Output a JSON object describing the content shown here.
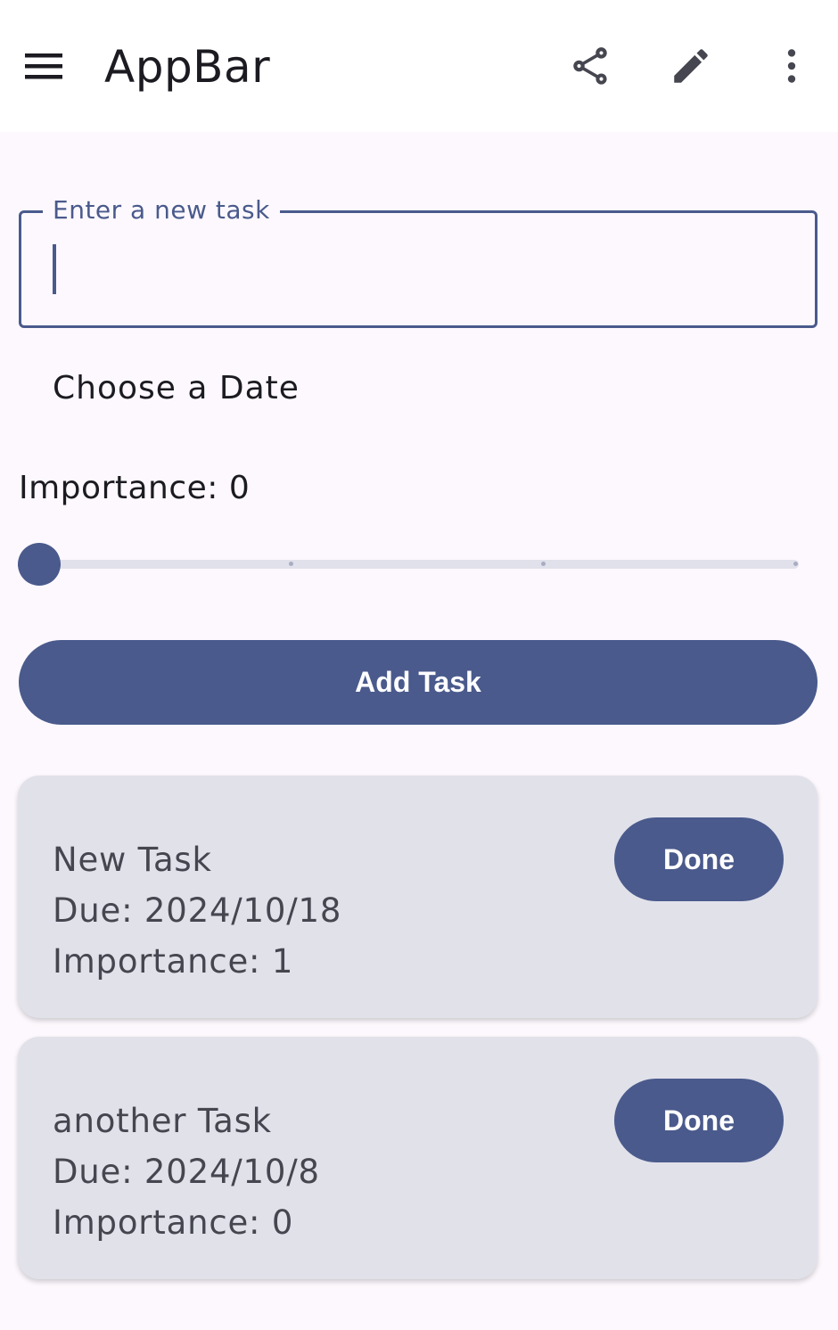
{
  "appbar": {
    "title": "AppBar",
    "icons": {
      "menu": "menu-icon",
      "share": "share-icon",
      "edit": "edit-icon",
      "more": "more-vert-icon"
    }
  },
  "form": {
    "task_input": {
      "label": "Enter a new task",
      "value": ""
    },
    "date_button_label": "Choose a Date",
    "importance": {
      "label": "Importance: 0",
      "value": 0,
      "min": 0,
      "max": 3
    },
    "add_button_label": "Add Task"
  },
  "tasks": [
    {
      "name": "New Task",
      "due": "Due: 2024/10/18",
      "importance": "Importance: 1",
      "done_label": "Done"
    },
    {
      "name": "another Task",
      "due": "Due: 2024/10/8",
      "importance": "Importance: 0",
      "done_label": "Done"
    }
  ],
  "colors": {
    "primary": "#4a5a8c",
    "background": "#fcf8fd",
    "card": "#e1e1ea",
    "appbar": "#ffffff"
  }
}
